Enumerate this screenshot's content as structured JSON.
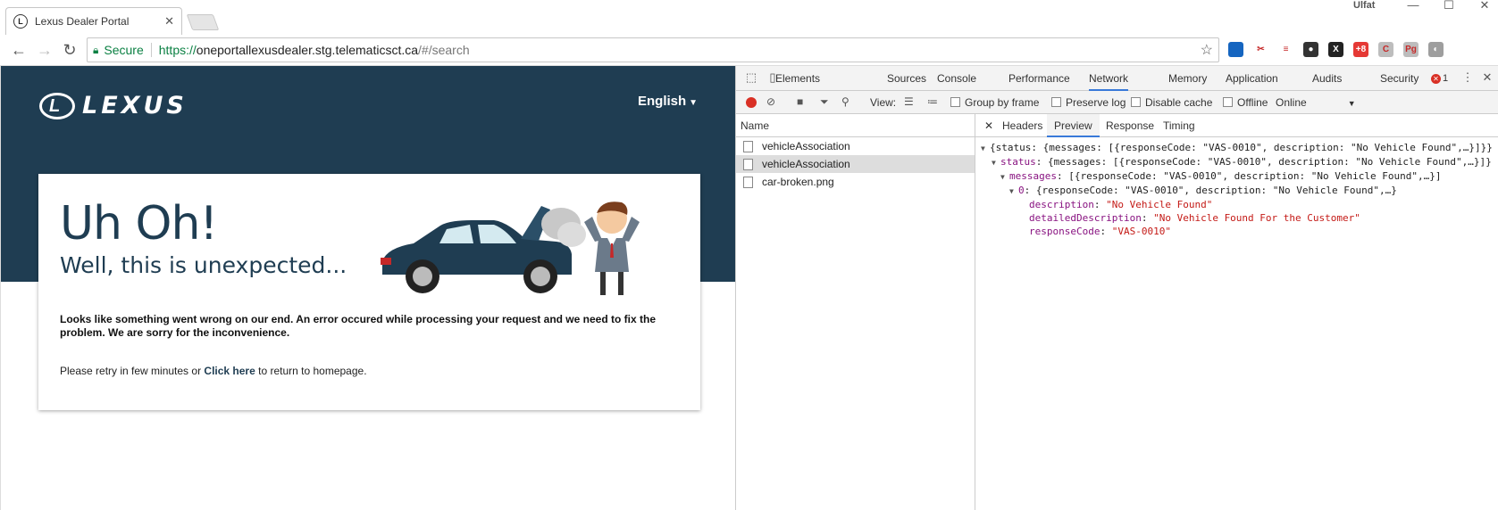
{
  "browser": {
    "tab_title": "Lexus Dealer Portal",
    "user": "Ulfat",
    "secure_label": "Secure",
    "url_scheme": "https://",
    "url_host": "oneportallexusdealer.stg.telematicsct.ca",
    "url_path": "/#/search",
    "extensions": [
      {
        "name": "ext-icon-1",
        "color": "#1565c0",
        "glyph": ""
      },
      {
        "name": "ext-icon-2",
        "color": "#ffffff",
        "glyph": "✂"
      },
      {
        "name": "ext-icon-3",
        "color": "#ffffff",
        "glyph": "≡"
      },
      {
        "name": "ext-icon-4",
        "color": "#333333",
        "glyph": "●"
      },
      {
        "name": "ext-icon-5",
        "color": "#222222",
        "glyph": "X"
      },
      {
        "name": "ext-icon-6",
        "color": "#e53935",
        "glyph": "+8"
      },
      {
        "name": "ext-icon-7",
        "color": "#bdbdbd",
        "glyph": "C"
      },
      {
        "name": "ext-icon-8",
        "color": "#bdbdbd",
        "glyph": "Pg"
      },
      {
        "name": "ext-icon-9",
        "color": "#9e9e9e",
        "glyph": "◐"
      }
    ]
  },
  "page": {
    "brand": "LEXUS",
    "language": "English",
    "headline": "Uh Oh!",
    "subheadline": "Well, this is unexpected...",
    "message": "Looks like something went wrong on our end. An error occured while processing your request and we need to fix the problem. We are sorry for the inconvenience.",
    "retry_prefix": "Please retry in few minutes or ",
    "retry_link": "Click here",
    "retry_suffix": " to return to homepage."
  },
  "devtools": {
    "tabs": [
      "Elements",
      "Sources",
      "Console",
      "Performance",
      "Network",
      "Memory",
      "Application",
      "Audits",
      "Security"
    ],
    "active_tab": "Network",
    "error_count": "1",
    "view_label": "View:",
    "group_by_frame": "Group by frame",
    "preserve_log": "Preserve log",
    "disable_cache": "Disable cache",
    "offline": "Offline",
    "throttle": "Online",
    "name_header": "Name",
    "requests": [
      "vehicleAssociation",
      "vehicleAssociation",
      "car-broken.png"
    ],
    "selected_request": 1,
    "detail_tabs": [
      "Headers",
      "Preview",
      "Response",
      "Timing"
    ],
    "active_detail_tab": "Preview",
    "preview": {
      "line0": "{status: {messages: [{responseCode: \"VAS-0010\", description: \"No Vehicle Found\",…}]}}",
      "line1_key": "status",
      "line1_val": ": {messages: [{responseCode: \"VAS-0010\", description: \"No Vehicle Found\",…}]}",
      "line2_key": "messages",
      "line2_val": ": [{responseCode: \"VAS-0010\", description: \"No Vehicle Found\",…}]",
      "line3_key": "0",
      "line3_val": ": {responseCode: \"VAS-0010\", description: \"No Vehicle Found\",…}",
      "description_key": "description",
      "description_val": "\"No Vehicle Found\"",
      "detailed_key": "detailedDescription",
      "detailed_val": "\"No Vehicle Found For the Customer\"",
      "code_key": "responseCode",
      "code_val": "\"VAS-0010\""
    }
  }
}
